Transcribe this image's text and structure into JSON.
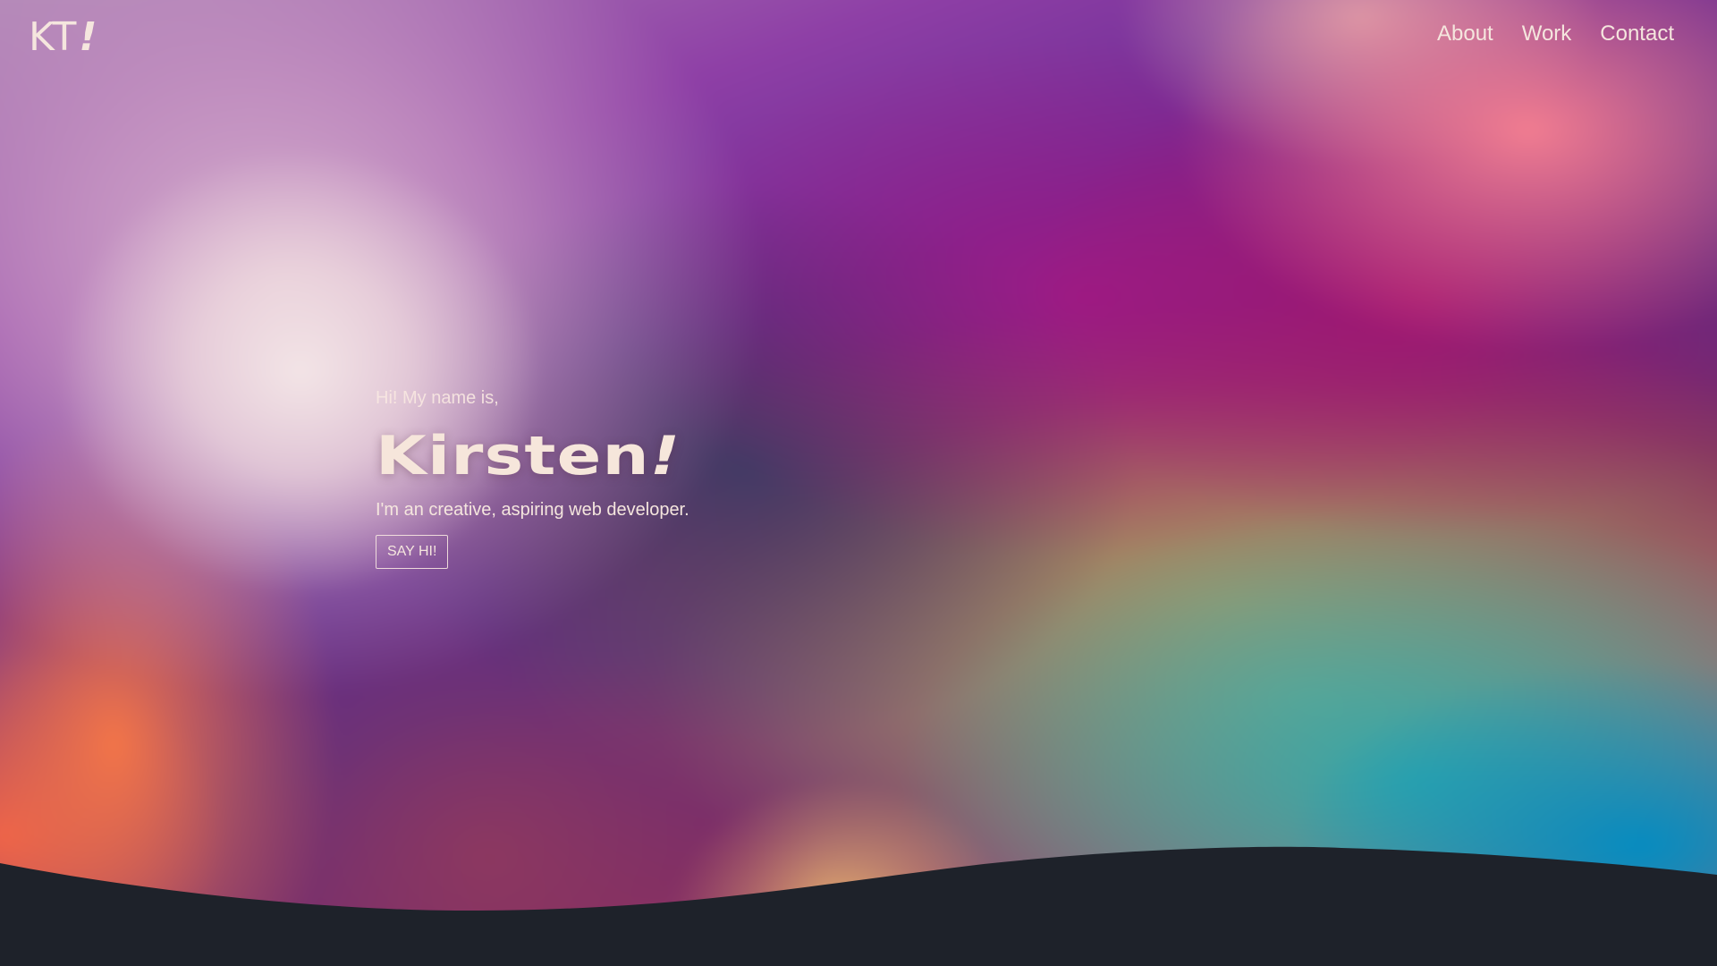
{
  "brand": {
    "logo_text": "KT",
    "logo_accent": "!"
  },
  "nav": {
    "items": [
      {
        "label": "About"
      },
      {
        "label": "Work"
      },
      {
        "label": "Contact"
      }
    ]
  },
  "hero": {
    "greeting": "Hi! My name is,",
    "name": "Kirsten",
    "name_accent": "!",
    "tagline": "I'm an creative, aspiring web developer.",
    "cta_label": "SAY HI!"
  },
  "colors": {
    "text": "#f5e6de",
    "footer_bg": "#1e222a"
  }
}
